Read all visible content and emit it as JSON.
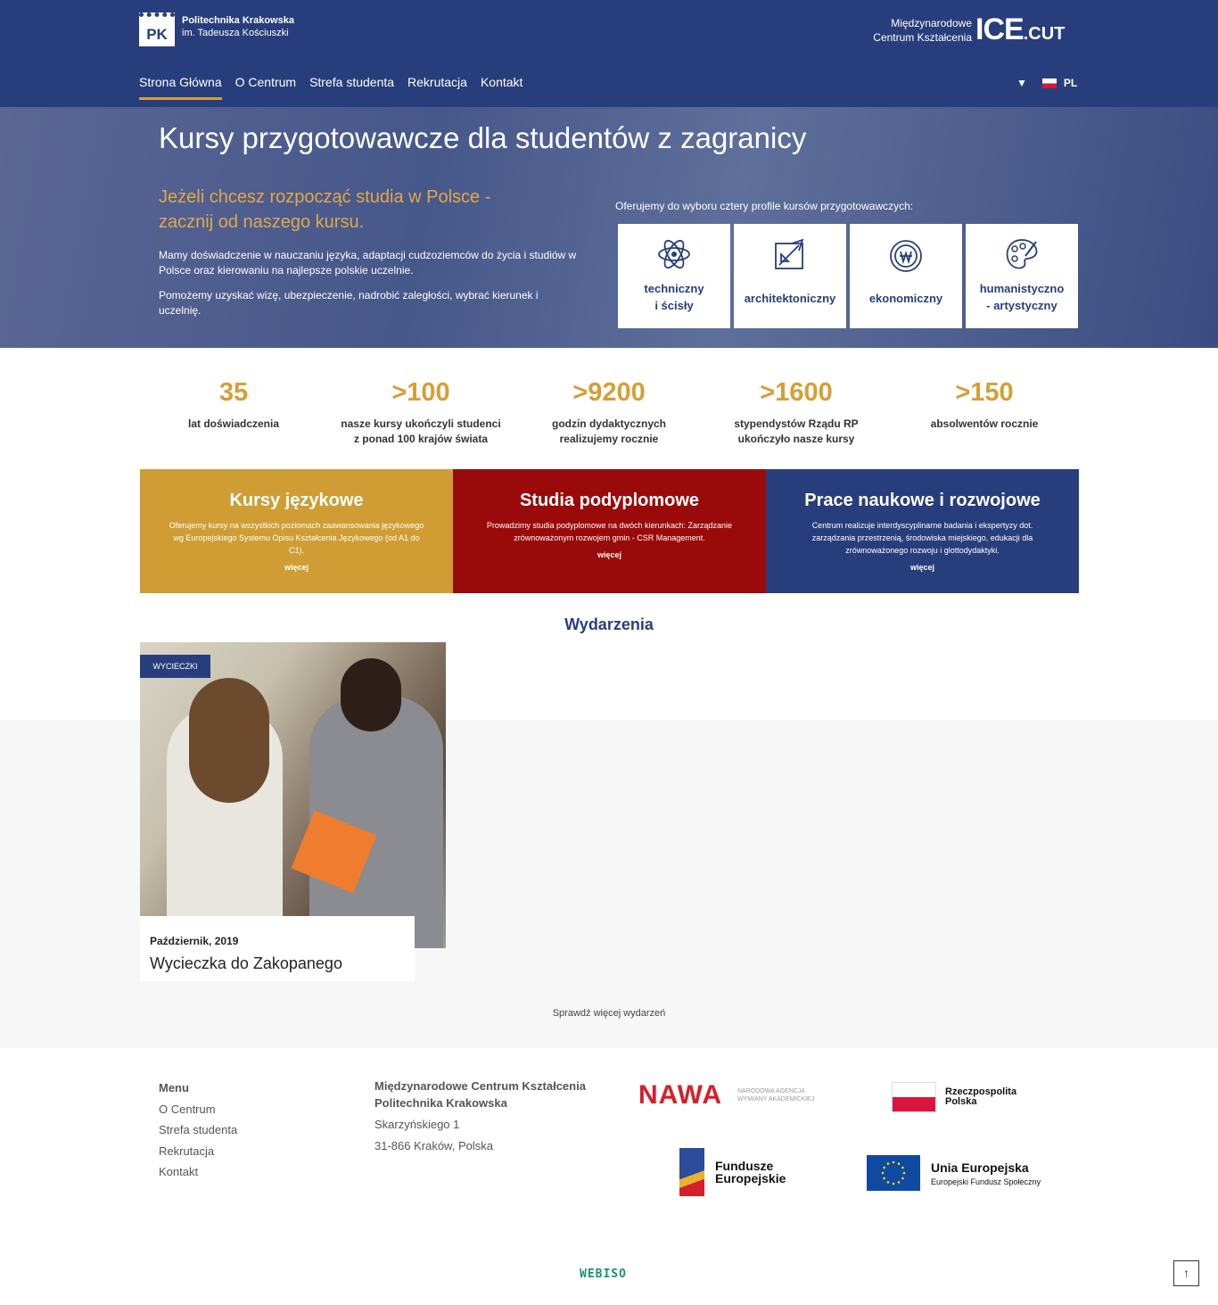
{
  "header": {
    "uni_name": "Politechnika Krakowska",
    "uni_sub": "im. Tadeusza Kościuszki",
    "logo_letters": "PK",
    "ice_sub": "Międzynarodowe Centrum Kształcenia",
    "ice_main": "ICE",
    "ice_suffix": ".CUT",
    "nav": [
      "Strona Główna",
      "O Centrum",
      "Strefa studenta",
      "Rekrutacja",
      "Kontakt"
    ],
    "lang_arrow": "▼",
    "lang": "PL"
  },
  "hero": {
    "title": "Kursy przygotowawcze dla studentów z zagranicy",
    "lead": "Jeżeli chcesz rozpocząć studia w Polsce - zacznij od naszego kursu.",
    "p1": "Mamy doświadczenie w nauczaniu języka, adaptacji cudzoziemców do życia i studiów w Polsce oraz kierowaniu na najlepsze polskie uczelnie.",
    "p2": "Pomożemy uzyskać wizę, ubezpieczenie, nadrobić zaległości, wybrać kierunek i uczelnię.",
    "offer": "Oferujemy do wyboru cztery profile kursów przygotowawczych:",
    "cards": [
      {
        "line1": "techniczny",
        "line2": "i ścisły",
        "icon": "atom-icon"
      },
      {
        "line1": "architektoniczny",
        "line2": "",
        "icon": "drafting-icon"
      },
      {
        "line1": "ekonomiczny",
        "line2": "",
        "icon": "coin-icon"
      },
      {
        "line1": "humanistyczno",
        "line2": "- artystyczny",
        "icon": "palette-icon"
      }
    ]
  },
  "stats": [
    {
      "num": "35",
      "l1": "lat doświadczenia",
      "l2": ""
    },
    {
      "num": ">100",
      "l1": "nasze kursy ukończyli studenci",
      "l2": "z ponad 100 krajów świata"
    },
    {
      "num": ">9200",
      "l1": "godzin dydaktycznych",
      "l2": "realizujemy rocznie"
    },
    {
      "num": ">1600",
      "l1": "stypendystów Rządu RP",
      "l2": "ukończyło nasze kursy"
    },
    {
      "num": ">150",
      "l1": "absolwentów rocznie",
      "l2": ""
    }
  ],
  "boxes": [
    {
      "title": "Kursy językowe",
      "desc": "Oferujemy kursy na wszystkich poziomach zaawansowania językowego wg Europejskiego Systemu Opisu Kształcenia Językowego (od A1 do C1).",
      "more": "więcej",
      "color": "#cf9d34"
    },
    {
      "title": "Studia podyplomowe",
      "desc": "Prowadzimy studia podyplomowe na dwóch kierunkach: Zarządzanie zrównoważonym rozwojem gmin - CSR Management.",
      "more": "więcej",
      "color": "#9b0a0a"
    },
    {
      "title": "Prace naukowe i rozwojowe",
      "desc": "Centrum realizuje interdyscyplinarne badania i ekspertyzy dot. zarządzania przestrzenią, środowiska miejskiego, edukacji dla zrównoważonego rozwoju i glottodydaktyki.",
      "more": "więcej",
      "color": "#283e7c"
    }
  ],
  "events": {
    "heading": "Wydarzenia",
    "tag": "WYCIECZKI",
    "date": "Październik, 2019",
    "title": "Wycieczka do Zakopanego",
    "more": "Sprawdź więcej wydarzeń"
  },
  "footer": {
    "menu_title": "Menu",
    "menu": [
      "O Centrum",
      "Strefa studenta",
      "Rekrutacja",
      "Kontakt"
    ],
    "addr1": "Międzynarodowe Centrum Kształcenia",
    "addr2": "Politechnika Krakowska",
    "addr3": "Skarzyńskiego 1",
    "addr4": "31-866 Kraków, Polska",
    "nawa": "NAWA",
    "nawa_sub1": "NARODOWA AGENCJA",
    "nawa_sub2": "WYMIANY AKADEMICKIEJ",
    "rp1": "Rzeczpospolita",
    "rp2": "Polska",
    "fe1": "Fundusze",
    "fe2": "Europejskie",
    "eu1": "Unia Europejska",
    "eu2": "Europejski Fundusz Społeczny",
    "credit": "WEBISO",
    "to_top": "↑"
  }
}
